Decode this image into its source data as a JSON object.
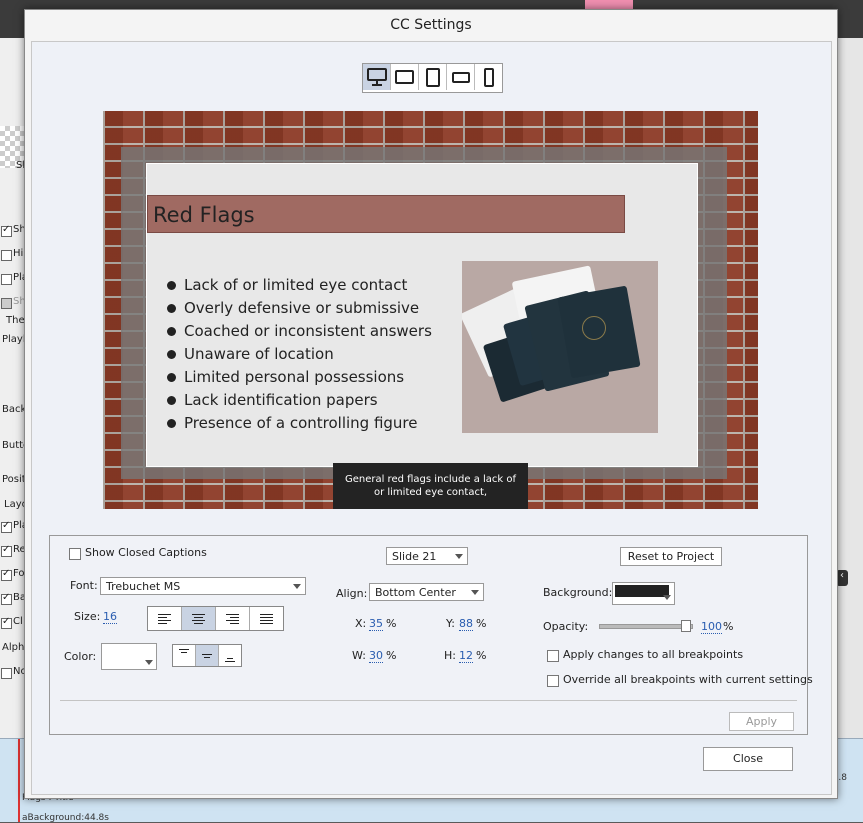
{
  "dialog": {
    "title": "CC Settings"
  },
  "devices": [
    {
      "name": "desktop-icon",
      "active": true
    },
    {
      "name": "tablet-landscape-icon",
      "active": false
    },
    {
      "name": "tablet-portrait-icon",
      "active": false
    },
    {
      "name": "phone-landscape-icon",
      "active": false
    },
    {
      "name": "phone-portrait-icon",
      "active": false
    }
  ],
  "slide": {
    "title": "Red Flags",
    "bullets": [
      "Lack of or limited eye contact",
      "Overly defensive or submissive",
      "Coached or inconsistent answers",
      "Unaware of location",
      "Limited personal possessions",
      "Lack identification papers",
      "Presence of a controlling figure"
    ],
    "caption": "General red flags include a lack of or limited eye contact,"
  },
  "settings": {
    "show_cc_label": "Show Closed Captions",
    "show_cc_checked": false,
    "slide_select": "Slide 21",
    "reset_button": "Reset to Project",
    "font_label": "Font:",
    "font_value": "Trebuchet MS",
    "size_label": "Size:",
    "size_value": "16",
    "color_label": "Color:",
    "align_label": "Align:",
    "align_value": "Bottom Center",
    "x_label": "X:",
    "x_value": "35",
    "y_label": "Y:",
    "y_value": "88",
    "w_label": "W:",
    "w_value": "30",
    "h_label": "H:",
    "h_value": "12",
    "percent": "%",
    "background_label": "Background:",
    "background_color": "#222222",
    "opacity_label": "Opacity:",
    "opacity_value": "100",
    "opacity_level": 1.0,
    "apply_all_label": "Apply changes to all breakpoints",
    "override_all_label": "Override all breakpoints with current settings",
    "apply_button": "Apply",
    "close_button": "Close"
  },
  "background_app": {
    "left_fragments": [
      "Sl",
      "Sh",
      "Hi",
      "Pla",
      "Sh",
      "The",
      "Playl",
      "Back",
      "Butto",
      "Positi",
      "Layo",
      "Pla",
      "Re",
      "Fo",
      "Ba",
      "Cl",
      "Alpha",
      "No"
    ],
    "right_fragment": "re :44.8",
    "bottom_fragments": [
      "Flags : Title",
      "aBackground:44.8s"
    ]
  },
  "colors": {
    "accent": "#2a5db0",
    "active_toggle": "#c9d3e3",
    "brick": "#8c3a26",
    "title_bar": "#a06a62"
  }
}
